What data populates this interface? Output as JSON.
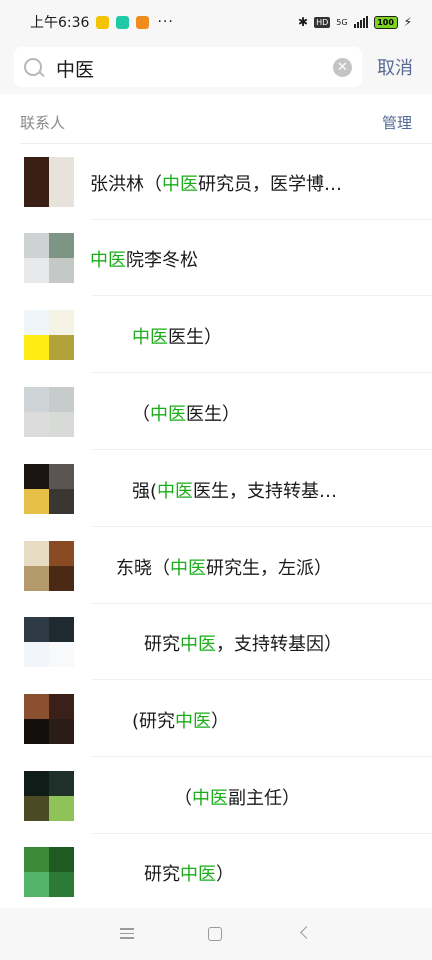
{
  "status_bar": {
    "time": "上午6:36",
    "dots": "···",
    "network": "5G",
    "hd": "HD",
    "battery": "100",
    "app_icons": [
      "#f3c200",
      "#1fc9a8",
      "#f08b1d"
    ]
  },
  "search": {
    "value": "中医",
    "cancel_label": "取消"
  },
  "section": {
    "title": "联系人",
    "manage_label": "管理"
  },
  "highlight_color": "#1aad19",
  "contacts": [
    {
      "prefix": "张洪林（",
      "match": "中医",
      "suffix": "研究员，医学博…",
      "colors": [
        "#3a1f14",
        "#e8e2dc",
        "#3a1f14",
        "#e8e2dc"
      ]
    },
    {
      "prefix": "",
      "match": "中医",
      "suffix": "院李冬松",
      "colors": [
        "#cfd2d3",
        "#7e9585",
        "#e7e9ea",
        "#c4c9c6"
      ]
    },
    {
      "prefix": "",
      "match": "中医",
      "suffix": "医生）",
      "colors": [
        "#eef6fa",
        "#f5f3e6",
        "#ffec12",
        "#b1a23a"
      ]
    },
    {
      "prefix": "（",
      "match": "中医",
      "suffix": "医生）",
      "colors": [
        "#cfd4d6",
        "#c7cbcc",
        "#dcdcdc",
        "#d8dad8"
      ]
    },
    {
      "prefix": "强(",
      "match": "中医",
      "suffix": "医生，支持转基…",
      "colors": [
        "#1b1412",
        "#5a5553",
        "#e7c04a",
        "#3a3632"
      ]
    },
    {
      "prefix": "东晓（",
      "match": "中医",
      "suffix": "研究生，左派）",
      "colors": [
        "#e8dcc5",
        "#8a4a24",
        "#b59a6e",
        "#4a2a14"
      ]
    },
    {
      "prefix": "研究",
      "match": "中医",
      "suffix": "，支持转基因）",
      "colors": [
        "#2e3b46",
        "#1e2a30",
        "#f2f6fa",
        "#f7f9fb"
      ]
    },
    {
      "prefix": "(研究",
      "match": "中医",
      "suffix": "）",
      "colors": [
        "#8a5030",
        "#3a2018",
        "#120e0c",
        "#2a1c16"
      ]
    },
    {
      "prefix": "（",
      "match": "中医",
      "suffix": "副主任）",
      "colors": [
        "#0f1c18",
        "#1f2f2a",
        "#4a4a24",
        "#8fc35a"
      ]
    },
    {
      "prefix": "研究",
      "match": "中医",
      "suffix": "）",
      "colors": [
        "#3a8a3a",
        "#1e5a22",
        "#54b46a",
        "#2c7a36"
      ]
    }
  ]
}
